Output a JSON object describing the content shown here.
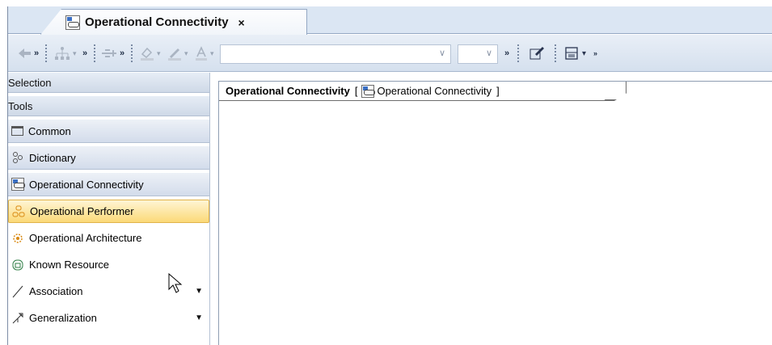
{
  "tab": {
    "title": "Operational Connectivity",
    "close": "×"
  },
  "toolbar": {
    "chevron": "»",
    "combo1_value": "",
    "combo2_value": ""
  },
  "palette": {
    "header_selection": "Selection",
    "header_tools": "Tools",
    "groups": [
      {
        "label": "Common",
        "icon": "folder-icon"
      },
      {
        "label": "Dictionary",
        "icon": "dictionary-icon"
      },
      {
        "label": "Operational Connectivity",
        "icon": "operational-connectivity-icon"
      }
    ],
    "items": [
      {
        "label": "Operational Performer",
        "icon": "operational-performer-icon",
        "active": true
      },
      {
        "label": "Operational Architecture",
        "icon": "operational-architecture-icon",
        "active": false
      },
      {
        "label": "Known Resource",
        "icon": "known-resource-icon",
        "active": false
      },
      {
        "label": "Association",
        "icon": "association-line-icon",
        "active": false,
        "dropdown": true
      },
      {
        "label": "Generalization",
        "icon": "generalization-arrow-icon",
        "active": false,
        "dropdown": true
      }
    ]
  },
  "diagram": {
    "title": "Operational Connectivity",
    "bracket_open": "[",
    "type_label": "Operational Connectivity",
    "bracket_close": "]"
  }
}
